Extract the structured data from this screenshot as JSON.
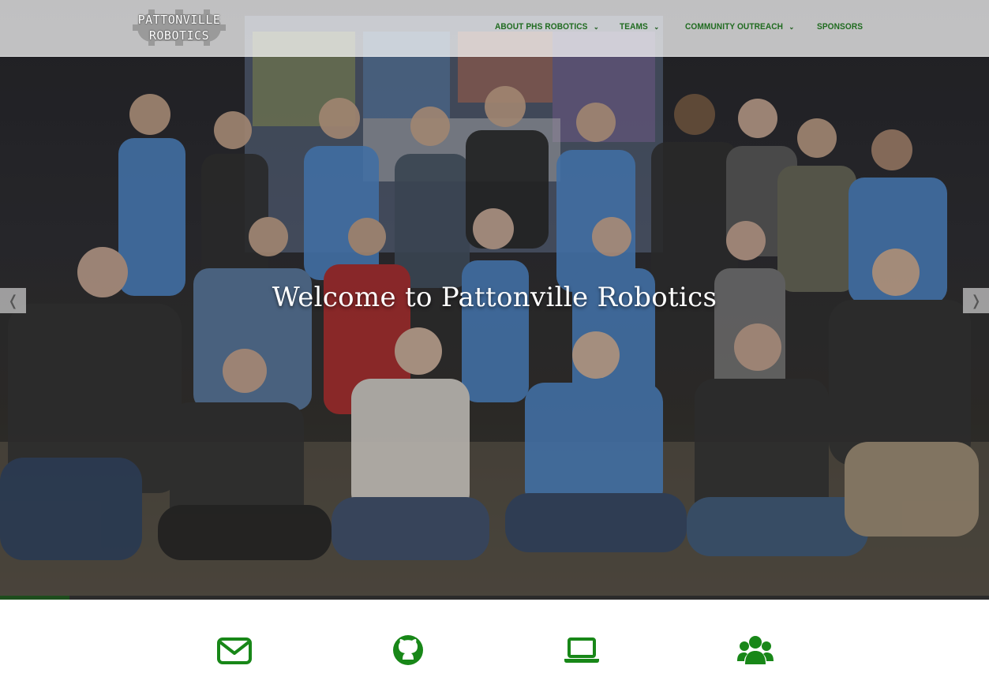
{
  "brand": {
    "logo_line1": "PATTONVILLE",
    "logo_line2": "ROBOTICS"
  },
  "nav": {
    "items": [
      {
        "label": "ABOUT PHS ROBOTICS",
        "has_submenu": true
      },
      {
        "label": "TEAMS",
        "has_submenu": true
      },
      {
        "label": "COMMUNITY OUTREACH",
        "has_submenu": true
      },
      {
        "label": "SPONSORS",
        "has_submenu": false
      }
    ],
    "chevron": "⌄"
  },
  "hero": {
    "headline": "Welcome to Pattonville Robotics",
    "prev_arrow": "❬",
    "next_arrow": "❭",
    "slide_progress_percent": 7
  },
  "icon_row": [
    {
      "icon": "envelope-icon"
    },
    {
      "icon": "github-icon"
    },
    {
      "icon": "laptop-icon"
    },
    {
      "icon": "users-icon"
    }
  ],
  "colors": {
    "nav_text": "#1f6b1f",
    "icon_green": "#188718",
    "nav_bg": "rgba(255,255,255,0.72)"
  }
}
